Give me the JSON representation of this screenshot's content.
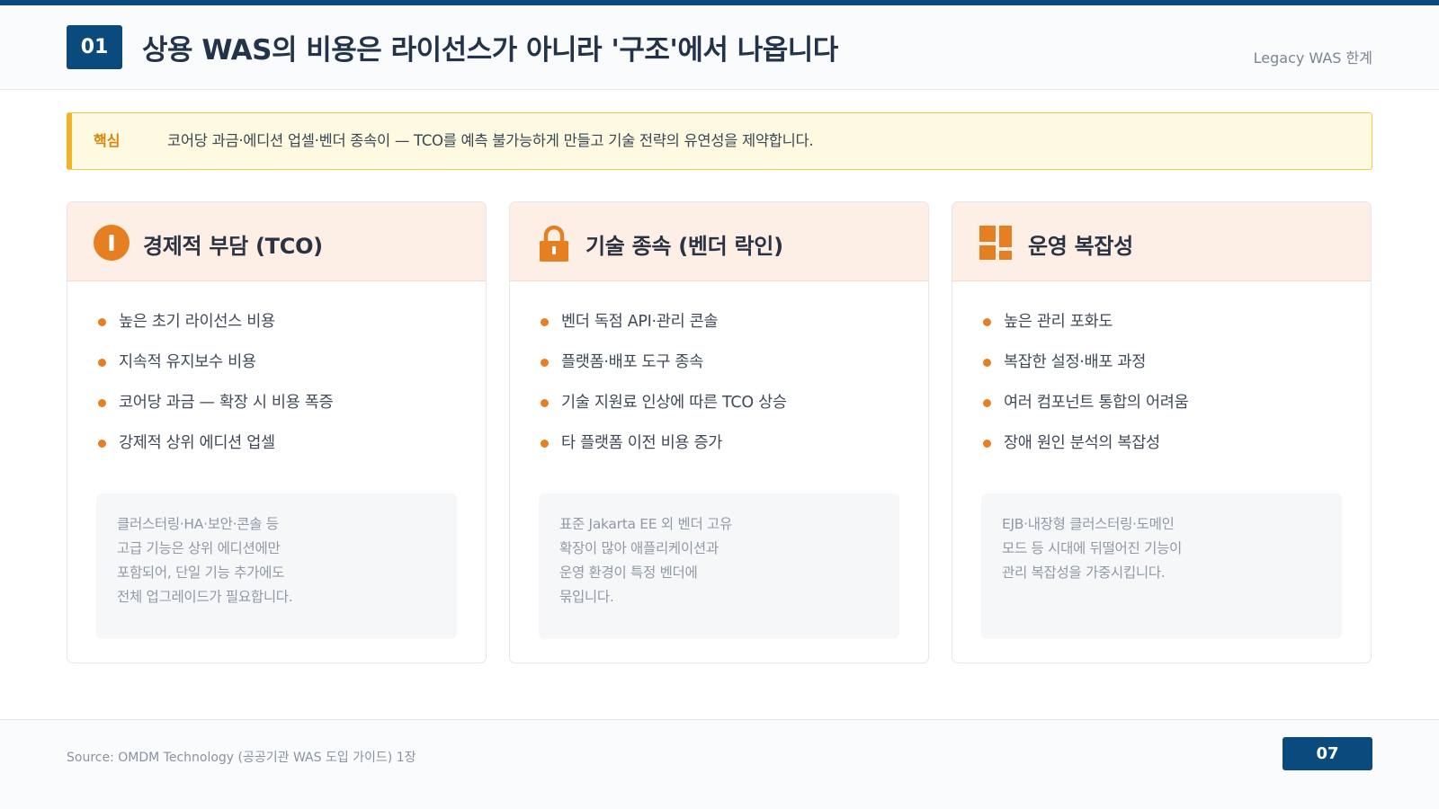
{
  "header": {
    "number": "01",
    "title": "상용 WAS의 비용은 라이선스가 아니라 '구조'에서 나옵니다",
    "section_tag": "Legacy WAS 한계"
  },
  "key_point": {
    "label": "핵심",
    "text": "코어당 과금·에디션 업셀·벤더 종속이 — TCO를 예측 불가능하게 만들고 기술 전략의 유연성을 제약합니다."
  },
  "cards": [
    {
      "icon": "alert-circle-icon",
      "title": "경제적 부담 (TCO)",
      "bullets": [
        "높은 초기 라이선스 비용",
        "지속적 유지보수 비용",
        "코어당 과금 — 확장 시 비용 폭증",
        "강제적 상위 에디션 업셀"
      ],
      "note": [
        "클러스터링·HA·보안·콘솔 등",
        "고급 기능은 상위 에디션에만",
        "포함되어, 단일 기능 추가에도",
        "전체 업그레이드가 필요합니다."
      ]
    },
    {
      "icon": "lock-icon",
      "title": "기술 종속 (벤더 락인)",
      "bullets": [
        "벤더 독점 API·관리 콘솔",
        "플랫폼·배포 도구 종속",
        "기술 지원료 인상에 따른 TCO 상승",
        "타 플랫폼 이전 비용 증가"
      ],
      "note": [
        "표준 Jakarta EE 외 벤더 고유",
        "확장이 많아 애플리케이션과",
        "운영 환경이 특정 벤더에",
        "묶입니다."
      ]
    },
    {
      "icon": "grid-blocks-icon",
      "title": "운영 복잡성",
      "bullets": [
        "높은 관리 포화도",
        "복잡한 설정·배포 과정",
        "여러 컴포넌트 통합의 어려움",
        "장애 원인 분석의 복잡성"
      ],
      "note": [
        "EJB·내장형 클러스터링·도메인",
        "모드 등 시대에 뒤떨어진 기능이",
        "관리 복잡성을 가중시킵니다."
      ]
    }
  ],
  "footer": {
    "source": "Source: OMDM Technology (공공기관 WAS 도입 가이드) 1장",
    "page_number": "07"
  },
  "colors": {
    "primary": "#0b4a7c",
    "accent": "#e67e22",
    "card_header_bg": "#fdeee6",
    "key_bg": "#fef9e1",
    "key_border": "#f0b429"
  }
}
